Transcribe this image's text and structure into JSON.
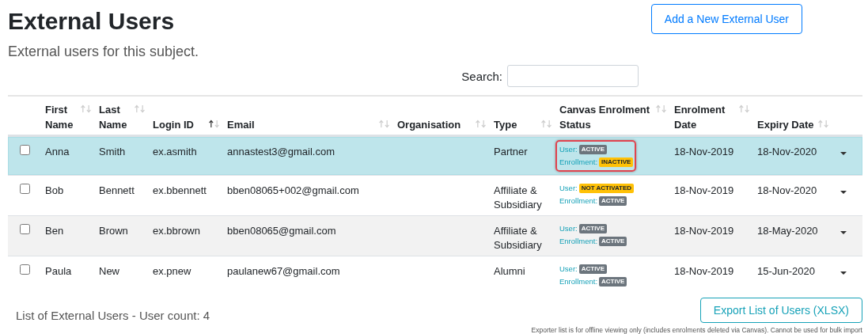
{
  "page": {
    "title": "External Users",
    "subtitle": "External users for this subject.",
    "add_button": "Add a New External User"
  },
  "search": {
    "label": "Search:"
  },
  "table": {
    "columns": [
      {
        "kind": "select"
      },
      {
        "kind": "sortable",
        "label": "First Name",
        "sorted_asc": false
      },
      {
        "kind": "sortable",
        "label": "Last Name",
        "sorted_asc": false
      },
      {
        "kind": "sortable",
        "label": "Login ID",
        "sorted_asc": true
      },
      {
        "kind": "sortable",
        "label": "Email",
        "sorted_asc": false
      },
      {
        "kind": "sortable",
        "label": "Organisation",
        "sorted_asc": false
      },
      {
        "kind": "sortable",
        "label": "Type",
        "sorted_asc": false
      },
      {
        "kind": "sortable",
        "label": "Canvas Enrolment Status",
        "sorted_asc": false
      },
      {
        "kind": "sortable",
        "label": "Enrolment Date",
        "sorted_asc": false
      },
      {
        "kind": "sortable",
        "label": "Expiry Date",
        "sorted_asc": false
      },
      {
        "kind": "action"
      }
    ],
    "rows": [
      {
        "selected": true,
        "checked": false,
        "status_highlighted": true,
        "first_name": "Anna",
        "last_name": "Smith",
        "login_id": "ex.asmith",
        "email": "annastest3@gmail.com",
        "type": "Partner",
        "user_label": "User:",
        "user_status": {
          "text": "ACTIVE",
          "color": "#6c757d"
        },
        "enrollment_label": "Enrollment:",
        "enrollment_status": {
          "text": "INACTIVE",
          "color": "#ffc107"
        },
        "enrolment_date": "18-Nov-2019",
        "expiry_date": "18-Nov-2020"
      },
      {
        "selected": false,
        "checked": false,
        "status_highlighted": false,
        "first_name": "Bob",
        "last_name": "Bennett",
        "login_id": "ex.bbennett",
        "email": "bben08065+002@gmail.com",
        "type": "Affiliate & Subsidiary",
        "user_label": "User:",
        "user_status": {
          "text": "NOT ACTIVATED",
          "color": "#ffc107"
        },
        "enrollment_label": "Enrollment:",
        "enrollment_status": {
          "text": "ACTIVE",
          "color": "#6c757d"
        },
        "enrolment_date": "18-Nov-2019",
        "expiry_date": "18-Nov-2020"
      },
      {
        "selected": false,
        "checked": false,
        "status_highlighted": false,
        "first_name": "Ben",
        "last_name": "Brown",
        "login_id": "ex.bbrown",
        "email": "bben08065@gmail.com",
        "type": "Affiliate & Subsidiary",
        "user_label": "User:",
        "user_status": {
          "text": "ACTIVE",
          "color": "#6c757d"
        },
        "enrollment_label": "Enrollment:",
        "enrollment_status": {
          "text": "ACTIVE",
          "color": "#6c757d"
        },
        "enrolment_date": "18-Nov-2019",
        "expiry_date": "18-May-2020"
      },
      {
        "selected": false,
        "checked": false,
        "status_highlighted": false,
        "first_name": "Paula",
        "last_name": "New",
        "login_id": "ex.pnew",
        "email": "paulanew67@gmail.com",
        "type": "Alumni",
        "user_label": "User:",
        "user_status": {
          "text": "ACTIVE",
          "color": "#6c757d"
        },
        "enrollment_label": "Enrollment:",
        "enrollment_status": {
          "text": "ACTIVE",
          "color": "#6c757d"
        },
        "enrolment_date": "18-Nov-2019",
        "expiry_date": "15-Jun-2020"
      }
    ]
  },
  "footer": {
    "count_text": "List of External Users - User count: 4",
    "export_button": "Export List of Users (XLSX)",
    "note": "Exporter list is for offline viewing only (includes enrolments deleted via Canvas). Cannot be used for bulk import"
  }
}
